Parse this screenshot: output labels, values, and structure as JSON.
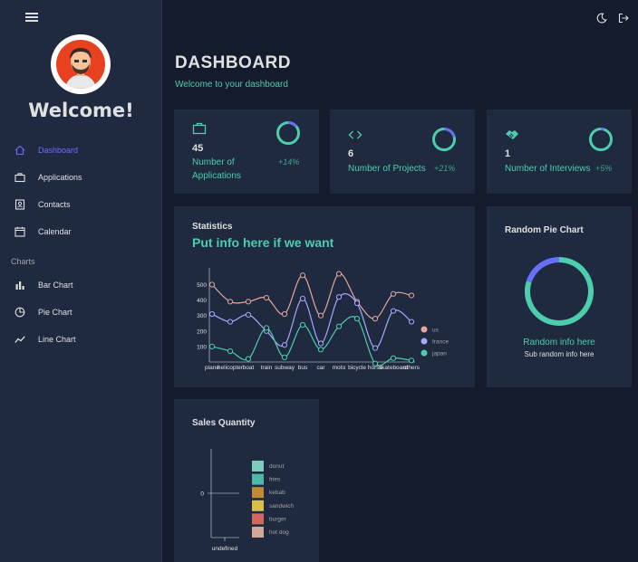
{
  "sidebar": {
    "welcome": "Welcome!",
    "items": [
      {
        "label": "Dashboard",
        "icon": "home-icon",
        "active": true
      },
      {
        "label": "Applications",
        "icon": "briefcase-icon"
      },
      {
        "label": "Contacts",
        "icon": "contact-card-icon"
      },
      {
        "label": "Calendar",
        "icon": "calendar-icon"
      }
    ],
    "section_charts": "Charts",
    "chart_items": [
      {
        "label": "Bar Chart",
        "icon": "bar-chart-icon"
      },
      {
        "label": "Pie Chart",
        "icon": "pie-chart-icon"
      },
      {
        "label": "Line Chart",
        "icon": "line-chart-icon"
      }
    ]
  },
  "header": {
    "title": "DASHBOARD",
    "subtitle": "Welcome to your dashboard"
  },
  "stats": [
    {
      "value": "45",
      "label": "Number of Applications",
      "pct": "+14%",
      "icon": "briefcase-icon",
      "progress": 0.14
    },
    {
      "value": "6",
      "label": "Number of Projects",
      "pct": "+21%",
      "icon": "code-icon",
      "progress": 0.21
    },
    {
      "value": "1",
      "label": "Number of Interviews",
      "pct": "+5%",
      "icon": "handshake-icon",
      "progress": 0.05
    }
  ],
  "statistics": {
    "title": "Statistics",
    "headline": "Put info here if we want"
  },
  "pie": {
    "title": "Random Pie Chart",
    "info": "Random info here",
    "sub": "Sub random info here"
  },
  "sales": {
    "title": "Sales Quantity"
  },
  "colors": {
    "accent_green": "#4cceac",
    "accent_blue": "#6870fa",
    "us": "#e2a69b",
    "france": "#a4a9fc",
    "japan": "#4cceac"
  },
  "chart_data": [
    {
      "type": "line",
      "categories": [
        "plane",
        "helicopter",
        "boat",
        "train",
        "subway",
        "bus",
        "car",
        "moto",
        "bicycle",
        "horse",
        "skateboard",
        "others"
      ],
      "series": [
        {
          "name": "us",
          "values": [
            500,
            390,
            390,
            415,
            310,
            560,
            300,
            570,
            390,
            280,
            440,
            430
          ]
        },
        {
          "name": "france",
          "values": [
            310,
            260,
            305,
            200,
            110,
            410,
            120,
            420,
            380,
            90,
            330,
            260
          ]
        },
        {
          "name": "japan",
          "values": [
            100,
            70,
            20,
            220,
            30,
            240,
            80,
            230,
            280,
            -10,
            25,
            10
          ]
        }
      ],
      "yticks": [
        100,
        200,
        300,
        400,
        500
      ],
      "ylim": [
        0,
        620
      ]
    },
    {
      "type": "pie",
      "slices": [
        {
          "value": 0.8,
          "color": "#4cceac"
        },
        {
          "value": 0.2,
          "color": "#6870fa"
        }
      ]
    },
    {
      "type": "bar",
      "categories": [
        "undefined"
      ],
      "series": [
        {
          "name": "donut",
          "color": "#7fcbbd"
        },
        {
          "name": "fries",
          "color": "#4eb9a8"
        },
        {
          "name": "kebab",
          "color": "#c08b36"
        },
        {
          "name": "sandwich",
          "color": "#d7c04a"
        },
        {
          "name": "burger",
          "color": "#d2675e"
        },
        {
          "name": "hot dog",
          "color": "#d1a99a"
        }
      ],
      "yticks": [
        0
      ]
    }
  ]
}
